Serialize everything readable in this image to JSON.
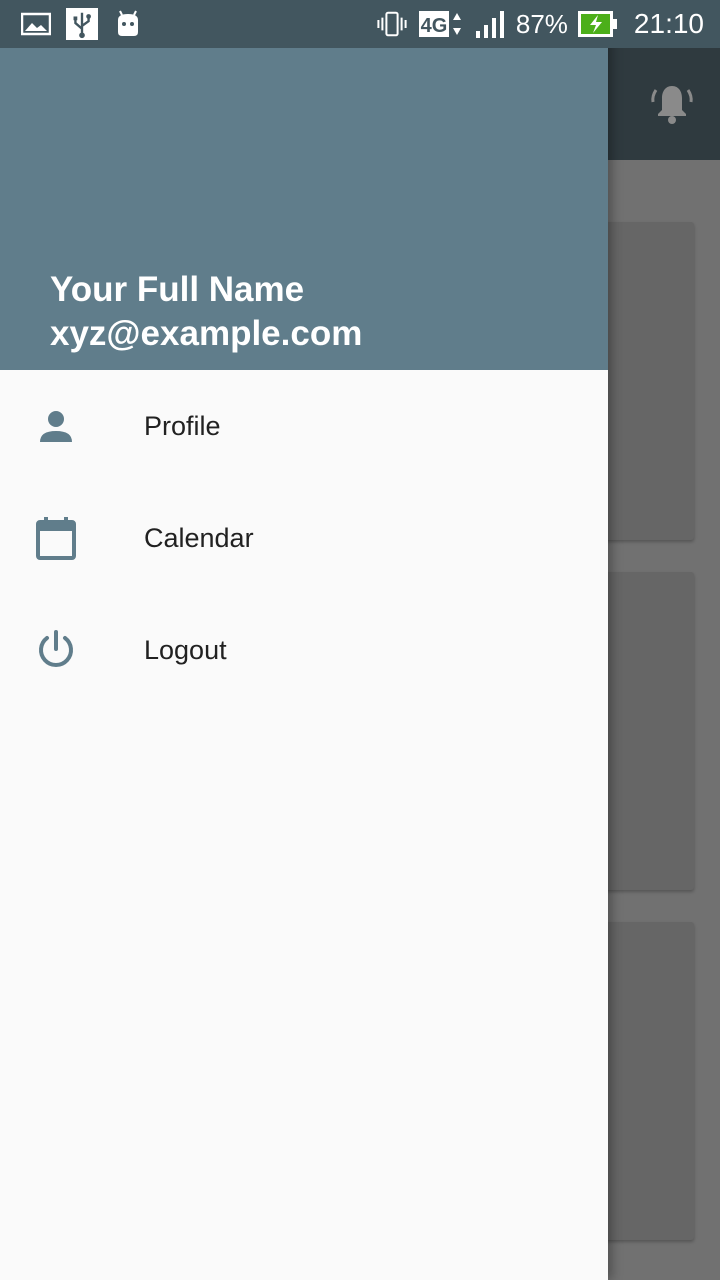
{
  "status_bar": {
    "network": "4G",
    "battery": "87%",
    "time": "21:10",
    "icons": [
      "gallery-icon",
      "usb-icon",
      "android-icon",
      "vibrate-icon",
      "network-4g-icon",
      "signal-icon",
      "battery-charging-icon"
    ]
  },
  "drawer": {
    "header": {
      "name": "Your Full Name",
      "email": "xyz@example.com"
    },
    "items": [
      {
        "label": "Profile",
        "icon": "person-icon"
      },
      {
        "label": "Calendar",
        "icon": "calendar-icon"
      },
      {
        "label": "Logout",
        "icon": "power-icon"
      }
    ]
  },
  "app_bar": {
    "actions": [
      "notification-bell-icon"
    ]
  },
  "colors": {
    "status_bar": "#42565f",
    "drawer_header": "#607d8b",
    "drawer_bg": "#fafafa",
    "icon_tint": "#607d8b",
    "scrim": "#717171"
  }
}
